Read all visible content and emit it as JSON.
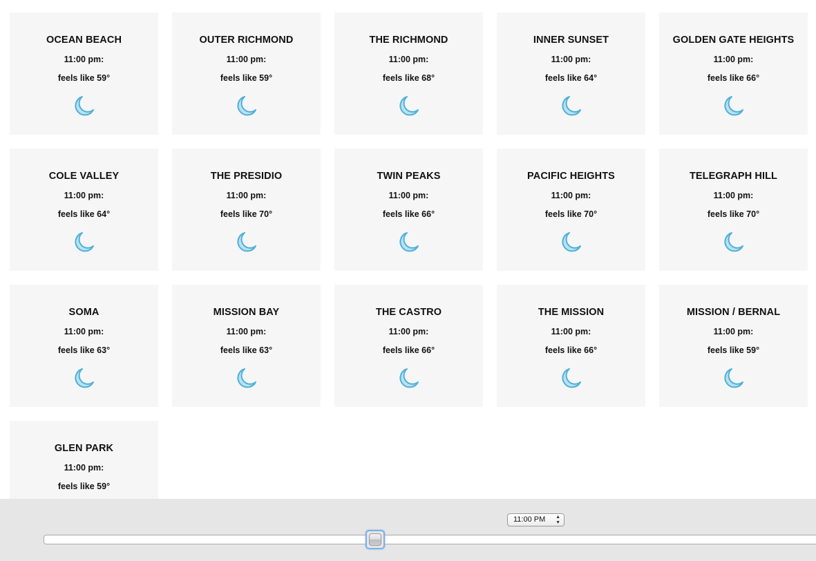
{
  "time_label": "11:00 pm:",
  "cards": [
    {
      "name": "OCEAN BEACH",
      "feels": "feels like 59°",
      "icon": "moon-icon"
    },
    {
      "name": "OUTER RICHMOND",
      "feels": "feels like 59°",
      "icon": "moon-icon"
    },
    {
      "name": "THE RICHMOND",
      "feels": "feels like 68°",
      "icon": "moon-icon"
    },
    {
      "name": "INNER SUNSET",
      "feels": "feels like 64°",
      "icon": "moon-icon"
    },
    {
      "name": "GOLDEN GATE HEIGHTS",
      "feels": "feels like 66°",
      "icon": "moon-icon"
    },
    {
      "name": "COLE VALLEY",
      "feels": "feels like 64°",
      "icon": "moon-icon"
    },
    {
      "name": "THE PRESIDIO",
      "feels": "feels like 70°",
      "icon": "moon-icon"
    },
    {
      "name": "TWIN PEAKS",
      "feels": "feels like 66°",
      "icon": "moon-icon"
    },
    {
      "name": "PACIFIC HEIGHTS",
      "feels": "feels like 70°",
      "icon": "moon-icon"
    },
    {
      "name": "TELEGRAPH HILL",
      "feels": "feels like 70°",
      "icon": "moon-icon"
    },
    {
      "name": "SOMA",
      "feels": "feels like 63°",
      "icon": "moon-icon"
    },
    {
      "name": "MISSION BAY",
      "feels": "feels like 63°",
      "icon": "moon-icon"
    },
    {
      "name": "THE CASTRO",
      "feels": "feels like 66°",
      "icon": "moon-icon"
    },
    {
      "name": "THE MISSION",
      "feels": "feels like 66°",
      "icon": "moon-icon"
    },
    {
      "name": "MISSION / BERNAL",
      "feels": "feels like 59°",
      "icon": "moon-icon"
    },
    {
      "name": "GLEN PARK",
      "feels": "feels like 59°",
      "icon": "moon-icon"
    }
  ],
  "controls": {
    "time_select_value": "11:00 PM",
    "slider_fraction": 0.42
  },
  "colors": {
    "moon_fill": "#b8e2f2",
    "moon_stroke": "#4fb0d8",
    "card_bg": "#f6f6f6",
    "footer_bg": "#e6e6e6"
  }
}
